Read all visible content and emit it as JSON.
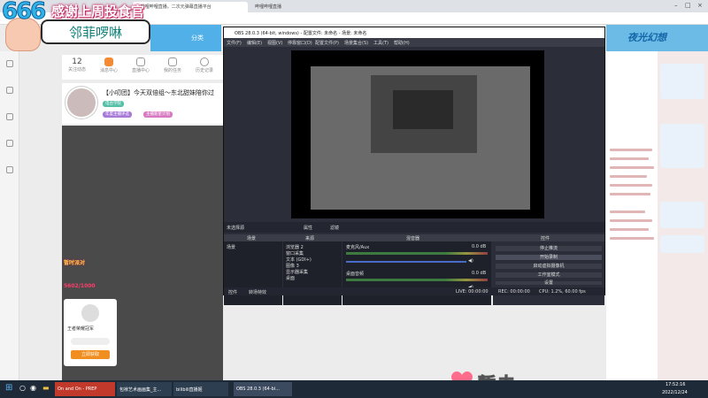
{
  "overlay": {
    "number": "666",
    "title": "感谢上周投食官",
    "name": "邻菲啰啉"
  },
  "browser": {
    "tab1": "...哔哩哔哩直播，二次元弹幕直播平台",
    "tab2": "哔哩哔哩直播"
  },
  "bili": {
    "nav_item": "分类",
    "right_banner": "夜光幻想"
  },
  "stats": [
    {
      "value": "12",
      "label": "关注动态"
    },
    {
      "value": "",
      "label": "消息中心"
    },
    {
      "value": "",
      "label": "直播中心"
    },
    {
      "value": "",
      "label": "我的任务"
    },
    {
      "value": "",
      "label": "历史记录"
    }
  ],
  "room": {
    "title": "【小叨团】今天双倍组～东北甜妹陪你过",
    "tag1": "电台学院",
    "tag2": "年度主播评选",
    "tag3": "主播新星计划"
  },
  "pk": {
    "label": "暂时派对",
    "number": "5602/1000"
  },
  "gift": {
    "title": "王者荣耀冠军",
    "button": "立即获取"
  },
  "obs": {
    "title": "OBS 28.0.3 (64-bit, windows) - 配置文件: 未命名 - 场景: 未命名",
    "menus": [
      "文件(F)",
      "编辑(E)",
      "视图(V)",
      "停靠窗口(D)",
      "配置文件(P)",
      "场景集合(S)",
      "工具(T)",
      "帮助(H)"
    ],
    "scene_label": "未选择源",
    "props_btn": "属性",
    "filter_btn": "滤镜",
    "docks": {
      "scenes": "场景",
      "sources": "来源",
      "mixer": "混音器",
      "controls": "控件"
    },
    "scene_item": "场景",
    "sources": [
      "浏览器 2",
      "窗口采集",
      "文本 (GDI+)",
      "图像 3",
      "显示器采集",
      "桌面"
    ],
    "mixer": {
      "mic": "麦克风/Aux",
      "mic_db": "0.0 dB",
      "desktop": "桌面音频",
      "desktop_db": "0.0 dB"
    },
    "controls": [
      "停止推流",
      "开始录制",
      "启动虚拟摄像机",
      "工作室模式",
      "设置",
      "退出"
    ],
    "control_tabs": [
      "控件",
      "转场特效"
    ],
    "status": {
      "live": "LIVE: 00:00:00",
      "rec": "REC: 00:00:00",
      "cpu": "CPU: 1.2%, 60.00 fps"
    }
  },
  "bottom": {
    "text": "暂未"
  },
  "taskbar": {
    "items": [
      "On and On - PREP",
      "包袱艺术画画集_主...",
      "bilibili直播姬",
      "OBS 28.0.3 (64-bi..."
    ],
    "time": "17:52:16",
    "date": "2022/12/24"
  },
  "colors": {
    "obs_bg": "#2b2e38",
    "bili_blue": "#51b0e8",
    "accent_pink": "#c0245e"
  }
}
